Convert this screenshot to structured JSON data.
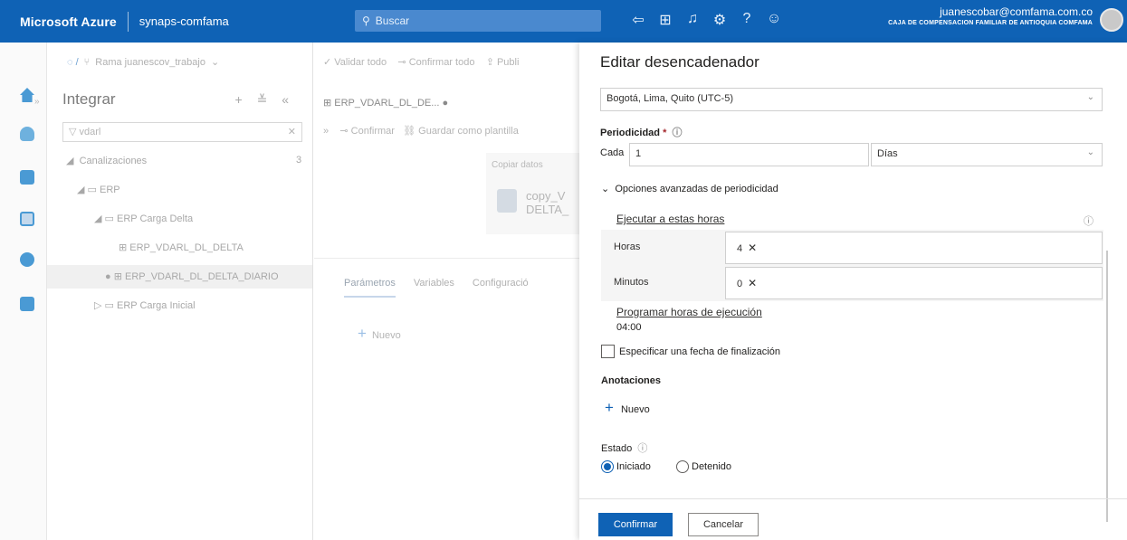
{
  "header": {
    "brand": "Microsoft Azure",
    "workspace": "synaps-comfama",
    "search_placeholder": "Buscar",
    "user_email": "juanescobar@comfama.com.co",
    "user_org": "CAJA DE COMPENSACION FAMILIAR DE ANTIOQUIA COMFAMA"
  },
  "explorer": {
    "branch_label": "Rama juanescov_trabajo",
    "title": "Integrar",
    "filter_value": "vdarl",
    "section": "Canalizaciones",
    "section_count": "3",
    "folder_erp": "ERP",
    "folder_delta": "ERP Carga Delta",
    "pipeline_1": "ERP_VDARL_DL_DELTA",
    "pipeline_2": "ERP_VDARL_DL_DELTA_DIARIO",
    "folder_inicial": "ERP Carga Inicial"
  },
  "canvas": {
    "validate_all": "Validar todo",
    "confirm_all": "Confirmar todo",
    "publish": "Publi",
    "tab_name": "ERP_VDARL_DL_DE...",
    "confirm": "Confirmar",
    "save_template": "Guardar como plantilla",
    "activity_type": "Copiar datos",
    "activity_name_1": "copy_V",
    "activity_name_2": "DELTA_",
    "tab_params": "Parámetros",
    "tab_vars": "Variables",
    "tab_config": "Configuració",
    "new_label": "Nuevo"
  },
  "panel": {
    "title": "Editar desencadenador",
    "timezone": "Bogotá, Lima, Quito (UTC-5)",
    "recurrence_label": "Periodicidad",
    "every_label": "Cada",
    "every_value": "1",
    "unit": "Días",
    "advanced_label": "Opciones avanzadas de periodicidad",
    "run_at_label": "Ejecutar a estas horas",
    "hours_label": "Horas",
    "hours_value": "4",
    "minutes_label": "Minutos",
    "minutes_value": "0",
    "schedule_label": "Programar horas de ejecución",
    "schedule_value": "04:00",
    "end_date_label": "Especificar una fecha de finalización",
    "annotations_label": "Anotaciones",
    "new_label": "Nuevo",
    "status_label": "Estado",
    "status_started": "Iniciado",
    "status_stopped": "Detenido",
    "confirm_button": "Confirmar",
    "cancel_button": "Cancelar"
  },
  "colors": {
    "accent": "#0f62b5",
    "header_bg": "#0f62b5"
  }
}
